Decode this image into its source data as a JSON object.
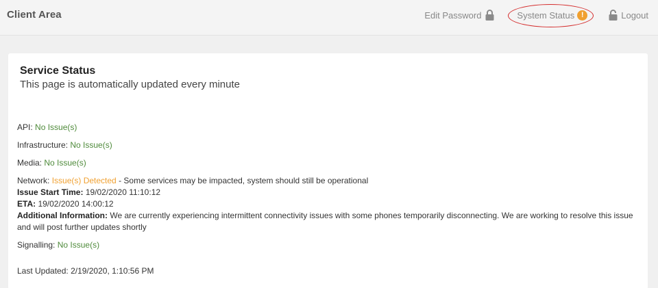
{
  "header": {
    "brand": "Client Area",
    "nav": {
      "edit_password": "Edit Password",
      "system_status": "System Status",
      "system_status_badge": "!",
      "logout": "Logout"
    }
  },
  "service_status": {
    "title": "Service Status",
    "subtitle": "This page is automatically updated every minute",
    "items": [
      {
        "name": "API:",
        "status": "No Issue(s)"
      },
      {
        "name": "Infrastructure:",
        "status": "No Issue(s)"
      },
      {
        "name": "Media:",
        "status": "No Issue(s)"
      }
    ],
    "network": {
      "name": "Network:",
      "status": "Issue(s) Detected",
      "impact": " - Some services may be impacted, system should still be operational",
      "start_time_label": "Issue Start Time:",
      "start_time": "19/02/2020 11:10:12",
      "eta_label": "ETA:",
      "eta": "19/02/2020 14:00:12",
      "additional_label": "Additional Information:",
      "additional": "We are currently experiencing intermittent connectivity issues with some phones temporarily disconnecting. We are working to resolve this issue and will post further updates shortly"
    },
    "signalling": {
      "name": "Signalling:",
      "status": "No Issue(s)"
    },
    "last_updated_label": "Last Updated:",
    "last_updated": "2/19/2020, 1:10:56 PM"
  },
  "colors": {
    "ok": "#4e8a3a",
    "warning": "#f0a030",
    "highlight": "#d42b2b"
  }
}
